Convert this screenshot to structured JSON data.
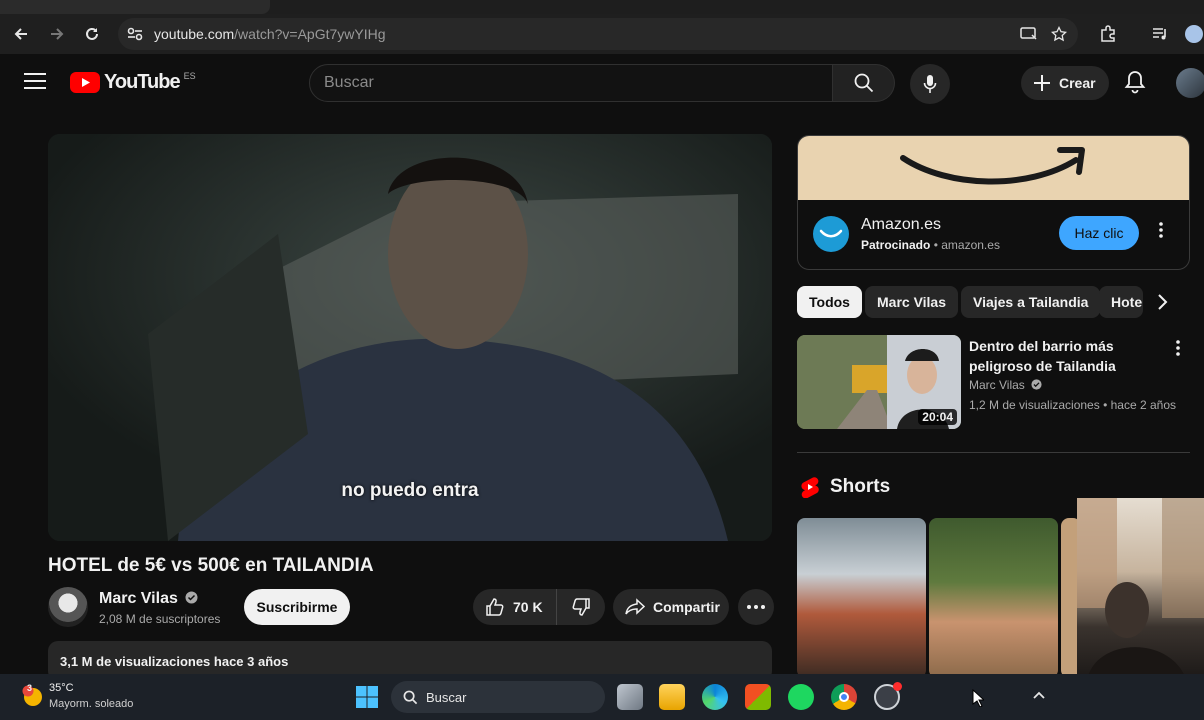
{
  "browser": {
    "url_host": "youtube.com",
    "url_path": "/watch?v=ApGt7ywYIHg"
  },
  "header": {
    "logo_text": "YouTube",
    "region": "ES",
    "search_placeholder": "Buscar",
    "create_label": "Crear"
  },
  "video": {
    "subtitle": "no puedo entra",
    "title": "HOTEL de 5€ vs 500€ en TAILANDIA",
    "channel": "Marc Vilas",
    "subscribers": "2,08 M de suscriptores",
    "subscribe_label": "Suscribirme",
    "likes": "70 K",
    "share_label": "Compartir",
    "stats": "3,1 M de visualizaciones  hace 3 años"
  },
  "ad": {
    "title": "Amazon.es",
    "sponsored": "Patrocinado",
    "domain": "• amazon.es",
    "cta": "Haz clic"
  },
  "chips": [
    "Todos",
    "Marc Vilas",
    "Viajes a Tailandia",
    "Hote"
  ],
  "recommendation": {
    "title": "Dentro del barrio más peligroso de Tailandia",
    "channel": "Marc Vilas",
    "meta": "1,2 M de visualizaciones • hace 2 años",
    "duration": "20:04"
  },
  "shorts_label": "Shorts",
  "taskbar": {
    "weather_temp": "35°C",
    "weather_desc": "Mayorm. soleado",
    "search_label": "Buscar",
    "weather_badge": "3"
  },
  "colors": {
    "background": "#0f0f0f",
    "youtube_red": "#ff0000",
    "cta_blue": "#3ea6ff",
    "chip_bg": "#272727"
  }
}
